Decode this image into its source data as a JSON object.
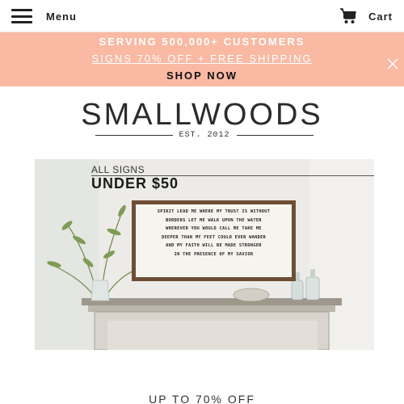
{
  "header": {
    "menu_label": "Menu",
    "cart_label": "Cart",
    "menu_icon": "hamburger-icon",
    "cart_icon": "shopping-cart-icon"
  },
  "promo": {
    "line1": "SERVING 500,000+ CUSTOMERS",
    "line2": "SIGNS 70% OFF + FREE SHIPPING",
    "line3": "SHOP NOW",
    "background": "#f9b9a3",
    "close_icon": "close-icon"
  },
  "logo": {
    "name": "SMALLWOODS",
    "tagline": "EST. 2012"
  },
  "hero": {
    "overlay_line1": "ALL SIGNS",
    "overlay_line2": "UNDER $50",
    "sign_lines": [
      "SPIRIT LEAD ME WHERE MY TRUST IS WITHOUT",
      "BORDERS LET ME WALK UPON THE WATER",
      "WHEREVER YOU WOULD CALL ME TAKE ME",
      "DEEPER THAN MY FEET COULD EVER WANDER",
      "AND MY FAITH WILL BE MADE STRONGER",
      "IN THE PRESENCE OF MY SAVIOR"
    ]
  },
  "section": {
    "heading": "UP TO 70% OFF"
  }
}
